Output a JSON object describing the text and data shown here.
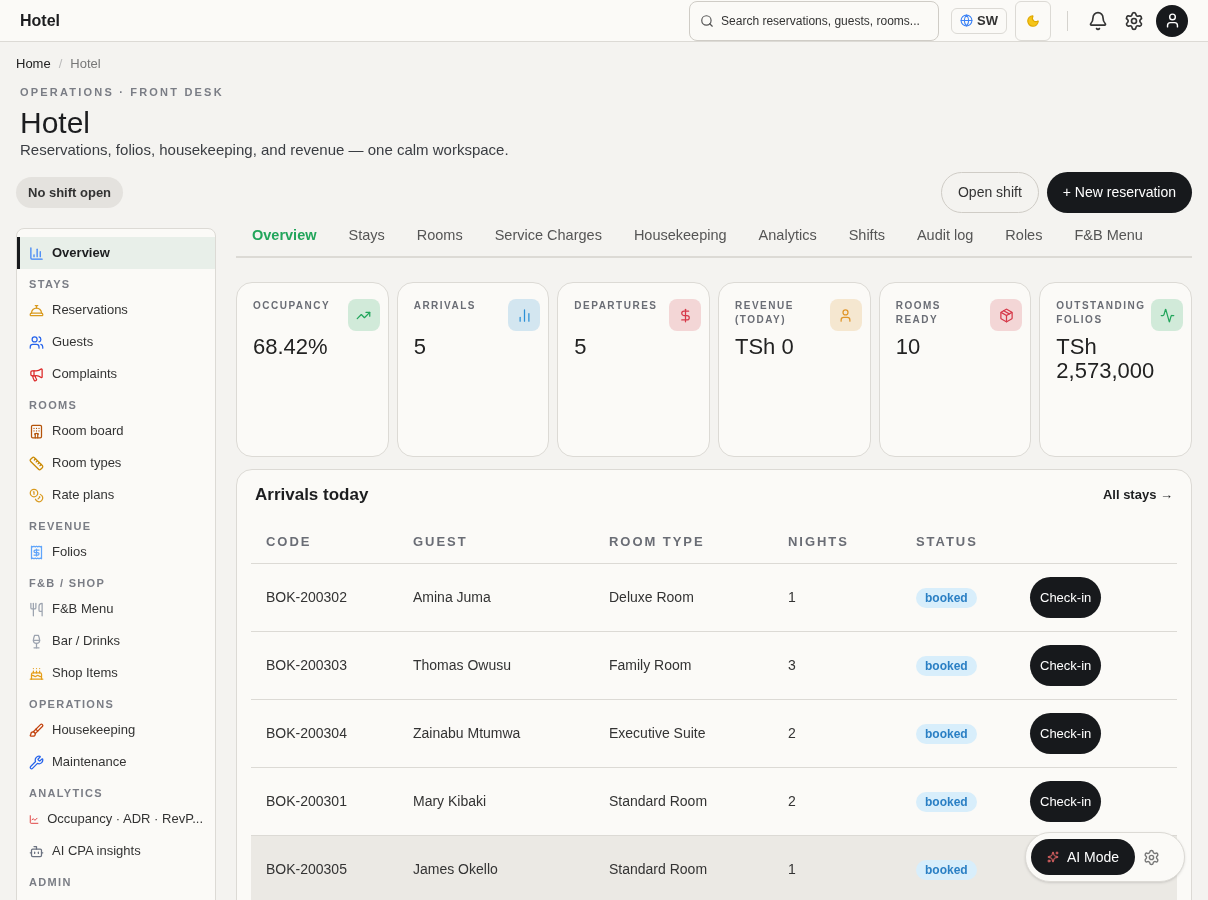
{
  "app": {
    "title": "Hotel"
  },
  "topbar": {
    "search": {
      "placeholder": "Search reservations, guests, rooms..."
    },
    "language": "SW"
  },
  "breadcrumb": {
    "separator": "/",
    "items": [
      {
        "label": "Home",
        "current": false
      },
      {
        "label": "Hotel",
        "current": true
      }
    ]
  },
  "header": {
    "eyebrow": "OPERATIONS · FRONT DESK",
    "title": "Hotel",
    "subtitle": "Reservations, folios, housekeeping, and revenue — one calm workspace.",
    "shift_badge": "No shift open",
    "buttons": [
      {
        "label": "Open shift",
        "kind": "secondary"
      },
      {
        "label": "+ New reservation",
        "kind": "primary"
      }
    ]
  },
  "sidebar": {
    "sections": [
      {
        "items": [
          {
            "label": "Overview",
            "selected": true
          }
        ]
      },
      {
        "heading": "STAYS",
        "items": [
          {
            "label": "Reservations",
            "selected": false
          },
          {
            "label": "Guests",
            "selected": false
          },
          {
            "label": "Complaints",
            "selected": false
          }
        ]
      },
      {
        "heading": "ROOMS",
        "items": [
          {
            "label": "Room board",
            "selected": false
          },
          {
            "label": "Room types",
            "selected": false
          },
          {
            "label": "Rate plans",
            "selected": false
          }
        ]
      },
      {
        "heading": "REVENUE",
        "items": [
          {
            "label": "Folios",
            "selected": false
          }
        ]
      },
      {
        "heading": "F&B / SHOP",
        "items": [
          {
            "label": "F&B Menu",
            "selected": false
          },
          {
            "label": "Bar / Drinks",
            "selected": false
          },
          {
            "label": "Shop Items",
            "selected": false
          }
        ]
      },
      {
        "heading": "OPERATIONS",
        "items": [
          {
            "label": "Housekeeping",
            "selected": false
          },
          {
            "label": "Maintenance",
            "selected": false
          }
        ]
      },
      {
        "heading": "ANALYTICS",
        "items": [
          {
            "label": "Occupancy · ADR · RevP...",
            "selected": false
          },
          {
            "label": "AI CPA insights",
            "selected": false
          }
        ]
      },
      {
        "heading": "ADMIN"
      }
    ]
  },
  "tabs": [
    {
      "label": "Overview",
      "selected": true
    },
    {
      "label": "Stays",
      "selected": false
    },
    {
      "label": "Rooms",
      "selected": false
    },
    {
      "label": "Service Charges",
      "selected": false
    },
    {
      "label": "Housekeeping",
      "selected": false
    },
    {
      "label": "Analytics",
      "selected": false
    },
    {
      "label": "Shifts",
      "selected": false
    },
    {
      "label": "Audit log",
      "selected": false
    },
    {
      "label": "Roles",
      "selected": false
    },
    {
      "label": "F&B Menu",
      "selected": false
    }
  ],
  "kpis": [
    {
      "label": "OCCUPANCY",
      "value": "68.42%",
      "color": "#22a55b"
    },
    {
      "label": "ARRIVALS",
      "value": "5",
      "color": "#2a8fd6"
    },
    {
      "label": "DEPARTURES",
      "value": "5",
      "color": "#d63a4a"
    },
    {
      "label": "REVENUE (TODAY)",
      "value": "TSh 0",
      "color": "#e0962a"
    },
    {
      "label": "ROOMS READY",
      "value": "10",
      "color": "#d63a4a"
    },
    {
      "label": "OUTSTANDING FOLIOS",
      "value": "TSh 2,573,000",
      "color": "#22a55b"
    }
  ],
  "arrivals": {
    "title": "Arrivals today",
    "link": "All stays →",
    "columns": [
      "CODE",
      "GUEST",
      "ROOM TYPE",
      "NIGHTS",
      "STATUS"
    ],
    "rows": [
      {
        "code": "BOK-200302",
        "guest": "Amina Juma",
        "room_type": "Deluxe Room",
        "nights": "1",
        "status": "booked",
        "action": "Check-in",
        "selected": false
      },
      {
        "code": "BOK-200303",
        "guest": "Thomas Owusu",
        "room_type": "Family Room",
        "nights": "3",
        "status": "booked",
        "action": "Check-in",
        "selected": false
      },
      {
        "code": "BOK-200304",
        "guest": "Zainabu Mtumwa",
        "room_type": "Executive Suite",
        "nights": "2",
        "status": "booked",
        "action": "Check-in",
        "selected": false
      },
      {
        "code": "BOK-200301",
        "guest": "Mary Kibaki",
        "room_type": "Standard Room",
        "nights": "2",
        "status": "booked",
        "action": "Check-in",
        "selected": false
      },
      {
        "code": "BOK-200305",
        "guest": "James Okello",
        "room_type": "Standard Room",
        "nights": "1",
        "status": "booked",
        "selected": true
      }
    ]
  },
  "ai_widget": {
    "label": "AI Mode"
  }
}
